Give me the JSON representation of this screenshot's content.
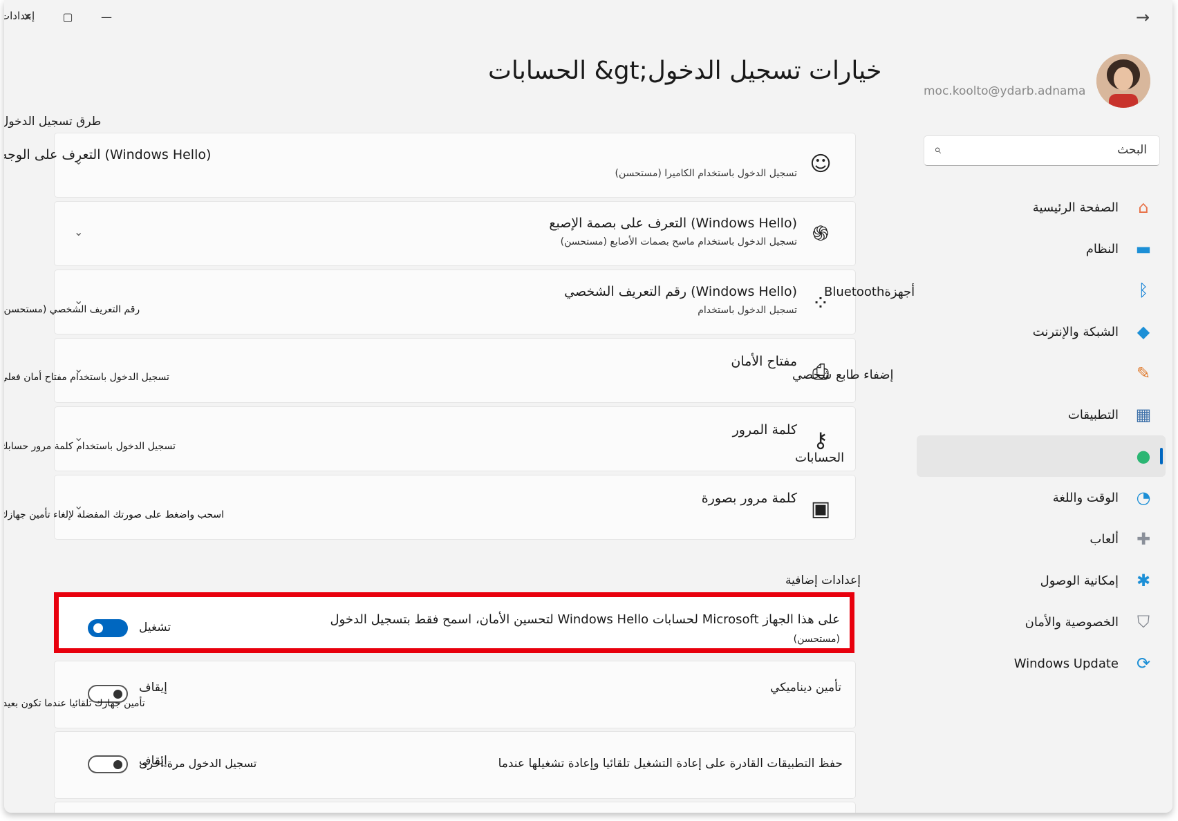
{
  "window": {
    "title": "إعدادات",
    "close_glyph": "✕",
    "maximize_glyph": "▢",
    "minimize_glyph": "—",
    "back_glyph": "→"
  },
  "profile": {
    "email": "amanda.brady@outlook.com",
    "email_mirrored": "moc.koolto@ydarb.adnama"
  },
  "search": {
    "placeholder": "البحث",
    "icon": "search-icon"
  },
  "nav": {
    "items": [
      {
        "label": "الصفحة الرئيسية",
        "icon": "home-icon",
        "glyph": "⌂",
        "color": "#e8734a"
      },
      {
        "label": "النظام",
        "icon": "system-display-icon",
        "glyph": "▬",
        "color": "#1c8fd6"
      },
      {
        "label": "",
        "icon": "bluetooth-icon",
        "glyph": "ᛒ",
        "color": "#0078d4"
      },
      {
        "label": "الشبكة والإنترنت",
        "icon": "wifi-icon",
        "glyph": "◆",
        "color": "#1c8fd6"
      },
      {
        "label": "",
        "icon": "personalization-brush-icon",
        "glyph": "✎",
        "color": "#e07a2c"
      },
      {
        "label": "التطبيقات",
        "icon": "apps-icon",
        "glyph": "▦",
        "color": "#3b6fa8"
      },
      {
        "label": "",
        "icon": "accounts-person-icon",
        "glyph": "●",
        "color": "#2bb673",
        "selected": true
      },
      {
        "label": "الوقت واللغة",
        "icon": "time-language-icon",
        "glyph": "◔",
        "color": "#1c8fd6"
      },
      {
        "label": "ألعاب",
        "icon": "gaming-controller-icon",
        "glyph": "✚",
        "color": "#8a8f99"
      },
      {
        "label": "إمكانية الوصول",
        "icon": "accessibility-icon",
        "glyph": "✱",
        "color": "#1c8fd6"
      },
      {
        "label": "الخصوصية والأمان",
        "icon": "shield-icon",
        "glyph": "⛉",
        "color": "#7a7f88"
      },
      {
        "label": "Windows Update",
        "icon": "windows-update-icon",
        "glyph": "⟳",
        "color": "#1c8fd6"
      }
    ]
  },
  "page": {
    "title": "الحسابات &gt;خيارات تسجيل الدخول"
  },
  "sections": {
    "sign_in_ways": "طرق تسجيل الدخول",
    "additional": "إعدادات إضافية"
  },
  "sign_in_options": [
    {
      "title": "التعرف على الوجه (Windows Hello)",
      "subtitle": "تسجيل الدخول باستخدام الكاميرا (مستحسن)",
      "icon": "face-smile-icon",
      "glyph": "☺"
    },
    {
      "title": "التعرف على بصمة الإصبع (Windows Hello)",
      "subtitle": "تسجيل الدخول باستخدام ماسح بصمات الأصابع (مستحسن)",
      "icon": "fingerprint-icon",
      "glyph": "֍"
    },
    {
      "title": "رقم التعريف الشخصي (Windows Hello)",
      "subtitle": "تسجيل الدخول باستخدام",
      "icon": "pin-keypad-icon",
      "glyph": "⁘",
      "stray_left": "رقم التعريف الشخصي (مستحسن)"
    },
    {
      "title": "مفتاح الأمان",
      "subtitle": "",
      "icon": "usb-key-icon",
      "glyph": "⎙",
      "stray_left": "تسجيل الدخول باستخدام مفتاح أمان فعلي"
    },
    {
      "title": "كلمة المرور",
      "subtitle": "",
      "icon": "key-icon",
      "glyph": "⚷",
      "stray_left": "تسجيل الدخول باستخدام كلمة مرور حسابك"
    },
    {
      "title": "كلمة مرور بصورة",
      "subtitle": "",
      "icon": "picture-icon",
      "glyph": "▣",
      "stray_left": "اسحب واضغط على صورتك المفضلة لإلغاء تأمين جهازك"
    }
  ],
  "overlaps": {
    "bluetooth_label": "Bluetoothأجهزة",
    "personalize_label": "إضفاء طابع شخصي",
    "accounts_label": "الحسابات"
  },
  "additional_settings": [
    {
      "title": "لتحسين الأمان، اسمح فقط بتسجيل الدخول Windows Hello لحسابات Microsoft على هذا الجهاز",
      "subtitle": "(مستحسن)",
      "state_label": "تشغيل",
      "on": true
    },
    {
      "title": "تأمين ديناميكي",
      "subtitle": "",
      "state_label": "إيقاف",
      "on": false,
      "stray_left": "تأمين جهازك تلقائيا عندما تكون بعيدا"
    },
    {
      "title": "حفظ التطبيقات القادرة على إعادة التشغيل تلقائيا وإعادة تشغيلها عندما",
      "subtitle": "",
      "state_label": "إيقاف",
      "on": false,
      "stray_left": "تسجيل الدخول مرة أخرى"
    }
  ],
  "colors": {
    "accent": "#0067c0",
    "highlight_border": "#e8000d"
  }
}
